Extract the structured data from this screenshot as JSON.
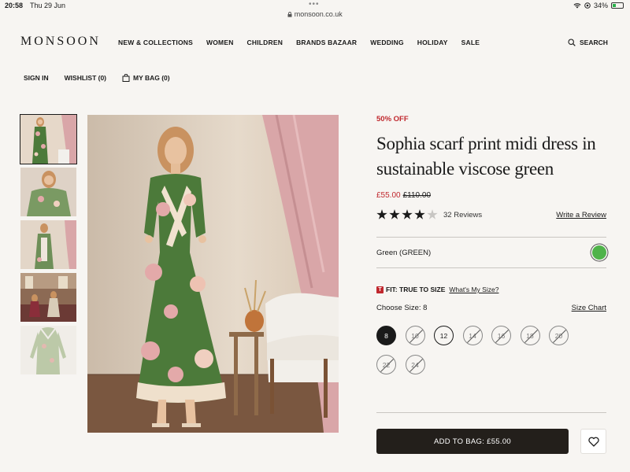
{
  "status_bar": {
    "time": "20:58",
    "date": "Thu 29 Jun",
    "url": "monsoon.co.uk",
    "battery": "34%",
    "battery_level": 0.34
  },
  "header": {
    "logo": "MONSOON",
    "nav": [
      "NEW & COLLECTIONS",
      "WOMEN",
      "CHILDREN",
      "BRANDS BAZAAR",
      "WEDDING",
      "HOLIDAY",
      "SALE"
    ],
    "search_label": "SEARCH"
  },
  "subnav": {
    "sign_in": "SIGN IN",
    "wishlist": "WISHLIST (0)",
    "bag": "MY BAG (0)"
  },
  "product": {
    "discount": "50% OFF",
    "title": "Sophia scarf print midi dress in sustainable viscose green",
    "price_now": "£55.00",
    "price_was": "£110.00",
    "rating": 4,
    "rating_max": 5,
    "reviews": "32 Reviews",
    "write_review": "Write a Review",
    "color": "Green (GREEN)",
    "swatch_color": "#4fb34a",
    "fit_icon": "T",
    "fit_text": "FIT: TRUE TO SIZE",
    "fit_link": "What's My Size?",
    "choose_size_label": "Choose Size:",
    "choose_size_value": "8",
    "size_chart": "Size Chart",
    "sizes": [
      {
        "label": "8",
        "state": "selected"
      },
      {
        "label": "10",
        "state": "oos"
      },
      {
        "label": "12",
        "state": "instock"
      },
      {
        "label": "14",
        "state": "oos"
      },
      {
        "label": "16",
        "state": "oos"
      },
      {
        "label": "18",
        "state": "oos"
      },
      {
        "label": "20",
        "state": "oos"
      },
      {
        "label": "22",
        "state": "oos"
      },
      {
        "label": "24",
        "state": "oos"
      }
    ],
    "add_to_bag": "ADD TO BAG: £55.00"
  },
  "colors": {
    "accent_red": "#c0282e",
    "button_dark": "#231f1b",
    "dress_green": "#4c7a3a",
    "curtain_pink": "#d9a6a8"
  },
  "gallery": {
    "thumbnail_count": 5,
    "active_thumbnail": 0
  }
}
